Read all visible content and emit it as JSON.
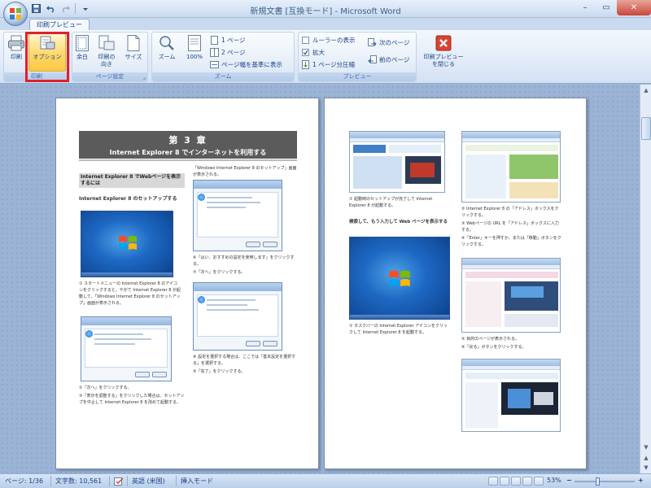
{
  "window": {
    "title": "新規文書 [互換モード] - Microsoft Word",
    "minimize": "–",
    "maximize": "▭",
    "close": "✕"
  },
  "quick_access": {
    "save_icon": "save-icon",
    "undo_icon": "undo-icon",
    "redo_icon": "redo-icon",
    "more_icon": "customize-icon"
  },
  "tabs": [
    {
      "label": "印刷プレビュー",
      "active": true
    }
  ],
  "ribbon": {
    "print_group": {
      "label": "印刷",
      "print_label": "印刷",
      "options_label": "オプション"
    },
    "page_setup_group": {
      "label": "ページ設定",
      "margins_label": "余白",
      "orientation_label": "印刷の\n向き",
      "size_label": "サイズ"
    },
    "zoom_group": {
      "label": "ズーム",
      "zoom_label": "ズーム",
      "percent_label": "100%",
      "one_page": "1 ページ",
      "two_pages": "2 ページ",
      "page_width": "ページ幅を基準に表示"
    },
    "preview_group": {
      "label": "プレビュー",
      "show_ruler": "ルーラーの表示",
      "magnifier": "拡大",
      "shrink_one_page": "1 ページ分圧縮",
      "next_page": "次のページ",
      "previous_page": "前のページ",
      "close_preview": "印刷プレビュー\nを閉じる"
    }
  },
  "document": {
    "chapter": "第 3 章",
    "chapter_subtitle": "Internet Explorer 8 でインターネットを利用する",
    "page1": {
      "heading1": "Internet Explorer 8 でWebページを表示するには",
      "heading2": "Internet Explorer 8 のセットアップする",
      "caption_right_top": "「Windows Internet Explorer 8 のセットアップ」画面が表示される。",
      "step1": "① スタートメニューの Internet Explorer 8 のアイコンをクリックすると、やがて Internet Explorer 8 が起動して、「Windows Internet Explorer 8 のセットアップ」画面が表示される。",
      "step_yes": "⑥「はい、おすすめの設定を使用します」をクリックする。",
      "step_next_right": "⑦「次へ」をクリックする。",
      "step_next_left": "②「次へ」をクリックする。",
      "step_settings": "③「表示を調整する」をクリックした場合は、セットアップを中止して Internet Explorer 8 を改めて起動する。",
      "step_select": "⑧ 設定を選択する場合は、ここでは「基本設定を選択する」を選択する。",
      "step_finish": "⑨「完了」をクリックする。"
    },
    "page2": {
      "caption1": "① 起動時のセットアップが完了して Internet Explorer 8 が起動する。",
      "heading": "検索して、もう入力して Web ページを表示する",
      "caption2": "① タスクバーの Internet Explorer アイコンをクリックして Internet Explorer 8 を起動する。",
      "right1": "② Internet Explorer 8 の「アドレス」ボックスをクリックする。",
      "right2": "③ Webページの URL を「アドレス」ボックスに入力する。",
      "right3": "④「Enter」キーを押すか、または「移動」ボタンをクリックする。",
      "right4": "⑤ 目的のページが表示される。",
      "right5": "⑥「戻る」ボタンをクリックする。"
    }
  },
  "statusbar": {
    "page": "ページ: 1/36",
    "word_count": "文字数: 10,561",
    "language": "英語 (米国)",
    "mode": "挿入モード",
    "zoom": "53%",
    "zoom_out": "−",
    "zoom_in": "+"
  },
  "colors": {
    "highlight": "#e0202a",
    "ribbon_text": "#15428b",
    "workspace": "#9bb3d4"
  }
}
